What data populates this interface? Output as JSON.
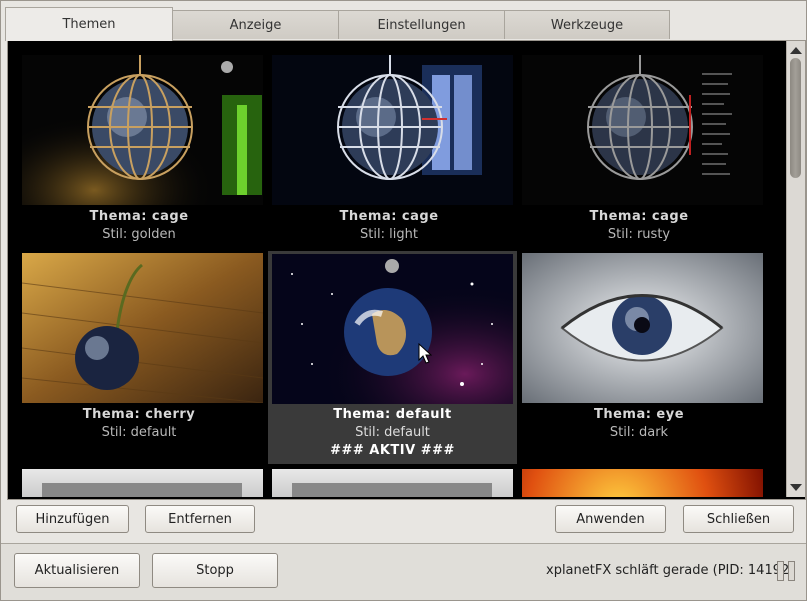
{
  "tabs": [
    "Themen",
    "Anzeige",
    "Einstellungen",
    "Werkzeuge"
  ],
  "themes": [
    {
      "thema": "Thema:  cage",
      "stil": "Stil:  golden"
    },
    {
      "thema": "Thema:  cage",
      "stil": "Stil:  light"
    },
    {
      "thema": "Thema:  cage",
      "stil": "Stil:  rusty"
    },
    {
      "thema": "Thema:  cherry",
      "stil": "Stil:  default"
    },
    {
      "thema": "Thema:  default",
      "stil": "Stil:  default",
      "active": "### AKTIV ###"
    },
    {
      "thema": "Thema:  eye",
      "stil": "Stil:  dark"
    }
  ],
  "panel_buttons": {
    "add": "Hinzufügen",
    "remove": "Entfernen",
    "apply": "Anwenden",
    "close": "Schließen"
  },
  "footer": {
    "refresh": "Aktualisieren",
    "stop": "Stopp",
    "status": "xplanetFX schläft gerade (PID: 14192)"
  },
  "colors": {
    "selected_bg": "#3a3a3a",
    "grid_bg": "#000000",
    "window_bg": "#e8e6e2"
  }
}
